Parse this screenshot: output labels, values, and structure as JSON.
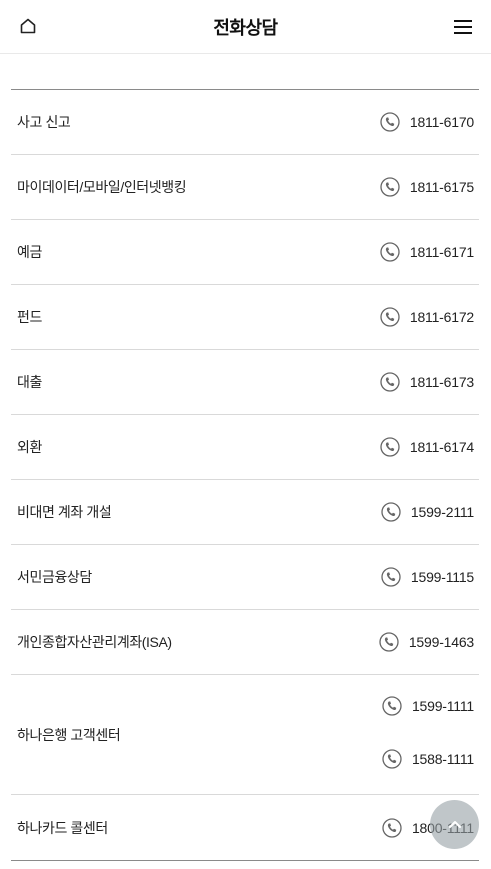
{
  "header": {
    "title": "전화상담",
    "home_icon": "home-icon",
    "menu_icon": "hamburger-menu-icon"
  },
  "contacts": [
    {
      "label": "사고 신고",
      "numbers": [
        "1811-6170"
      ]
    },
    {
      "label": "마이데이터/모바일/인터넷뱅킹",
      "numbers": [
        "1811-6175"
      ]
    },
    {
      "label": "예금",
      "numbers": [
        "1811-6171"
      ]
    },
    {
      "label": "펀드",
      "numbers": [
        "1811-6172"
      ]
    },
    {
      "label": "대출",
      "numbers": [
        "1811-6173"
      ]
    },
    {
      "label": "외환",
      "numbers": [
        "1811-6174"
      ]
    },
    {
      "label": "비대면 계좌 개설",
      "numbers": [
        "1599-2111"
      ]
    },
    {
      "label": "서민금융상담",
      "numbers": [
        "1599-1115"
      ]
    },
    {
      "label": "개인종합자산관리계좌(ISA)",
      "numbers": [
        "1599-1463"
      ]
    },
    {
      "label": "하나은행 고객센터",
      "numbers": [
        "1599-1111",
        "1588-1111"
      ]
    },
    {
      "label": "하나카드 콜센터",
      "numbers": [
        "1800-1111"
      ]
    }
  ],
  "phone_icon": "phone-icon",
  "scroll_top_icon": "arrow-up-icon",
  "colors": {
    "divider": "#d9d9d9",
    "list_border": "#8a8a8a",
    "icon": "#666666",
    "top_button": "#a0aaaf"
  }
}
